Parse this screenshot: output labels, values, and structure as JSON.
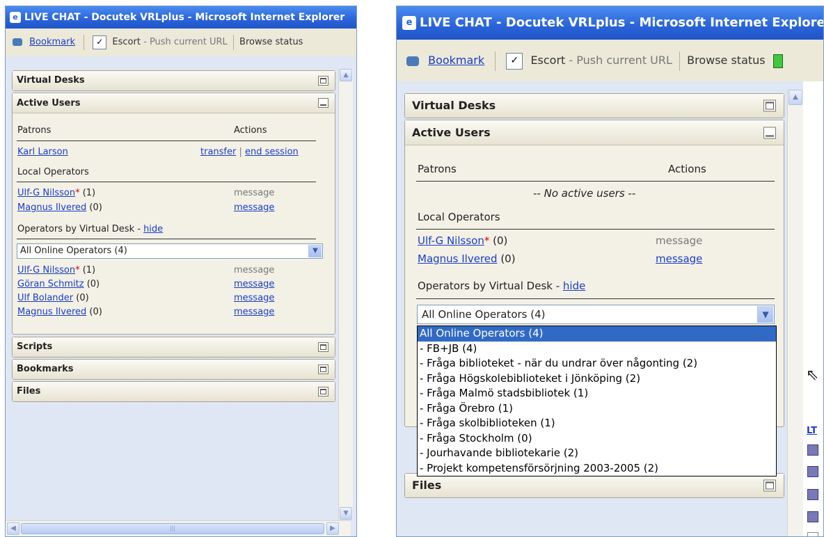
{
  "window_title": "LIVE CHAT - Docutek VRLplus - Microsoft Internet Explorer",
  "toolbar": {
    "bookmark": "Bookmark",
    "check": "✓",
    "escort": "Escort",
    "dash": "-",
    "push_url": "Push current URL",
    "browse_status": "Browse status"
  },
  "panels": {
    "virtual_desks": "Virtual Desks",
    "active_users": "Active Users",
    "scripts": "Scripts",
    "bookmarks": "Bookmarks",
    "files": "Files"
  },
  "active_users": {
    "patrons_header": "Patrons",
    "actions_header": "Actions",
    "local_operators_header": "Local Operators",
    "by_desk_label": "Operators by Virtual Desk -",
    "hide_link": "hide",
    "message": "message"
  },
  "left": {
    "patron": {
      "name": "Karl Larson",
      "transfer": "transfer",
      "sep": "|",
      "end": "end session"
    },
    "local_ops": [
      {
        "name": "Ulf-G Nilsson",
        "star": "*",
        "count": "(1)"
      },
      {
        "name": "Magnus Ilvered",
        "star": "",
        "count": "(0)"
      }
    ],
    "select_value": "All Online Operators (4)",
    "desk_ops": [
      {
        "name": "Ulf-G Nilsson",
        "star": "*",
        "count": "(1)"
      },
      {
        "name": "Göran Schmitz",
        "star": "",
        "count": "(0)"
      },
      {
        "name": "Ulf Bolander",
        "star": "",
        "count": "(0)"
      },
      {
        "name": "Magnus Ilvered",
        "star": "",
        "count": "(0)"
      }
    ]
  },
  "right": {
    "no_users": "-- No active users --",
    "local_ops": [
      {
        "name": "Ulf-G Nilsson",
        "star": "*",
        "count": "(0)"
      },
      {
        "name": "Magnus Ilvered",
        "star": "",
        "count": "(0)"
      }
    ],
    "select_value": "All Online Operators (4)",
    "dropdown_options": [
      "All Online Operators (4)",
      "- FB+JB (4)",
      "- Fråga biblioteket - när du undrar över någonting (2)",
      "- Fråga Högskolebiblioteket i Jönköping (2)",
      "- Fråga Malmö stadsbibliotek (1)",
      "- Fråga Örebro (1)",
      "- Fråga skolbiblioteken (1)",
      "- Fråga Stockholm (0)",
      "- Jourhavande bibliotekarie (2)",
      "- Projekt kompetensförsörjning 2003-2005 (2)"
    ],
    "side_link": "LT"
  },
  "colors": {
    "title_blue": "#2a63d8",
    "link": "#1a3cc8",
    "highlight": "#316ac5",
    "star": "#dd0000"
  },
  "icons": [
    "ie-logo-icon",
    "bookmark-icon",
    "checkbox-icon",
    "minimize-icon",
    "maximize-icon",
    "dropdown-arrow-icon",
    "scroll-up-icon",
    "scroll-down-icon",
    "scroll-left-icon",
    "scroll-right-icon",
    "status-green-icon",
    "mouse-cursor-icon"
  ]
}
